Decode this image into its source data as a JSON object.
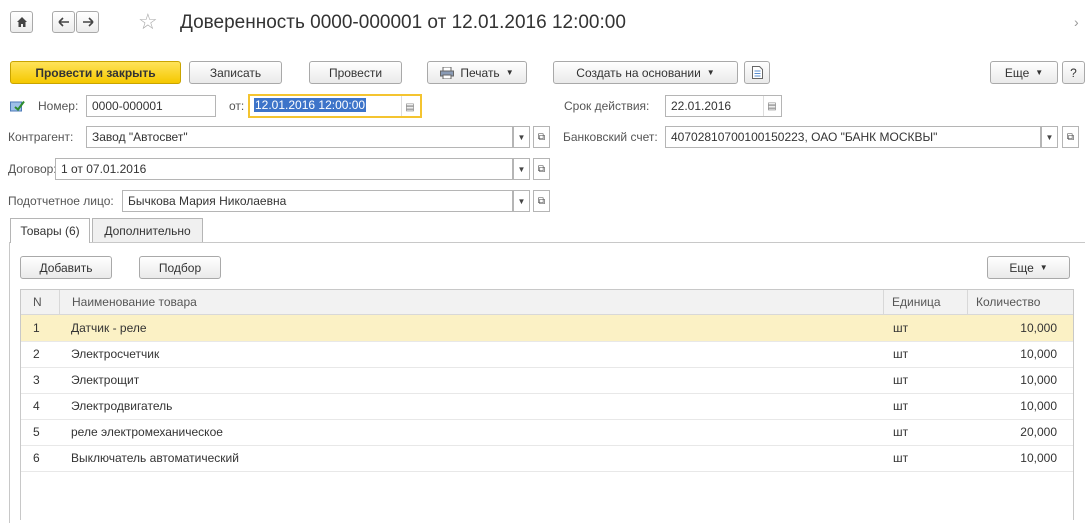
{
  "header": {
    "home_icon": "home-icon",
    "back_icon": "arrow-left-icon",
    "forward_icon": "arrow-right-icon",
    "star_icon": "star-icon",
    "star": "☆",
    "title": "Доверенность 0000-000001 от 12.01.2016 12:00:00",
    "close_glyph": "›"
  },
  "toolbar": {
    "post_and_close": "Провести и закрыть",
    "save": "Записать",
    "post": "Провести",
    "print": "Печать",
    "create_based_on": "Создать на основании",
    "more": "Еще",
    "help": "?"
  },
  "form": {
    "number_label": "Номер:",
    "number_value": "0000-000001",
    "from_label": "от:",
    "date_value": "12.01.2016 12:00:00",
    "valid_until_label": "Срок действия:",
    "valid_until_value": "22.01.2016",
    "contractor_label": "Контрагент:",
    "contractor_value": "Завод \"Автосвет\"",
    "bank_account_label": "Банковский счет:",
    "bank_account_value": "40702810700100150223, ОАО \"БАНК МОСКВЫ\"",
    "contract_label": "Договор:",
    "contract_value": "1 от 07.01.2016",
    "accountable_label": "Подотчетное лицо:",
    "accountable_value": "Бычкова Мария Николаевна"
  },
  "tabs": [
    {
      "label": "Товары (6)"
    },
    {
      "label": "Дополнительно"
    }
  ],
  "table_toolbar": {
    "add": "Добавить",
    "pick": "Подбор",
    "more": "Еще"
  },
  "table": {
    "columns": [
      "N",
      "Наименование товара",
      "Единица",
      "Количество"
    ],
    "rows": [
      {
        "n": "1",
        "name": "Датчик - реле",
        "unit": "шт",
        "qty": "10,000"
      },
      {
        "n": "2",
        "name": "Электросчетчик",
        "unit": "шт",
        "qty": "10,000"
      },
      {
        "n": "3",
        "name": "Электрощит",
        "unit": "шт",
        "qty": "10,000"
      },
      {
        "n": "4",
        "name": "Электродвигатель",
        "unit": "шт",
        "qty": "10,000"
      },
      {
        "n": "5",
        "name": "реле электромеханическое",
        "unit": "шт",
        "qty": "20,000"
      },
      {
        "n": "6",
        "name": "Выключатель автоматический",
        "unit": "шт",
        "qty": "10,000"
      }
    ]
  },
  "colors": {
    "primary_button": "#f5c800",
    "selected_row": "#fbf1c5",
    "selection": "#3d74c9"
  }
}
